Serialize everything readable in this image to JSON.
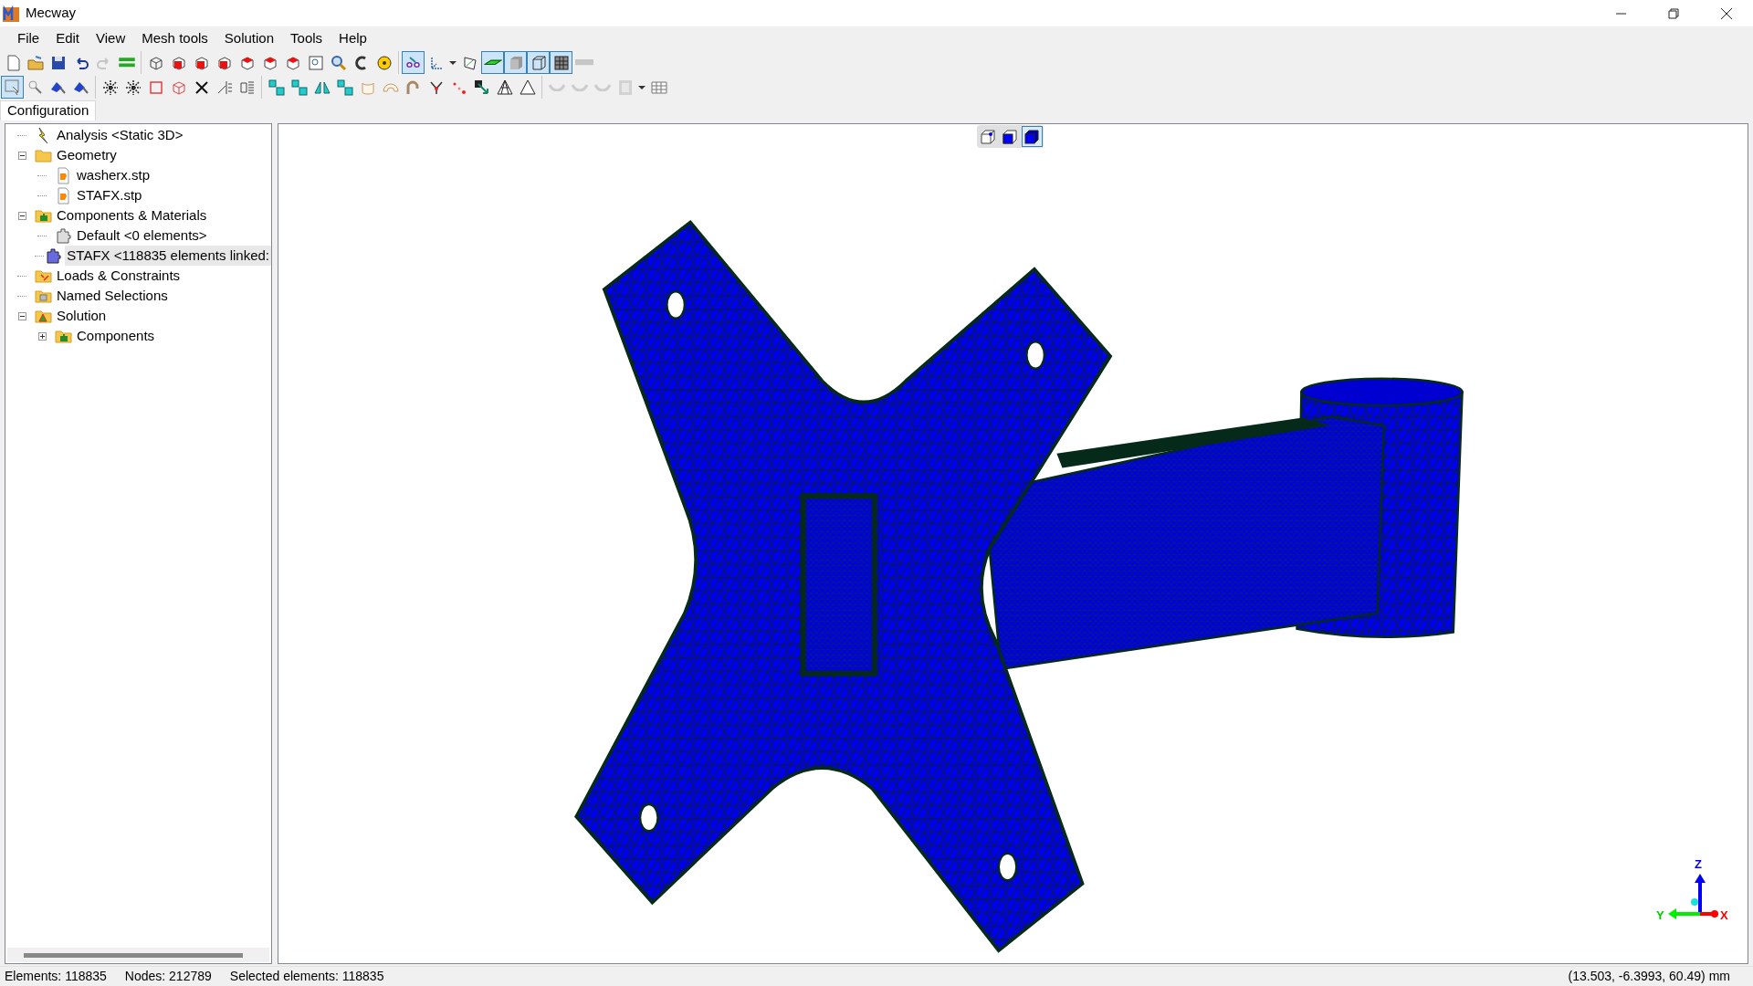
{
  "window": {
    "title": "Mecway"
  },
  "menu": [
    "File",
    "Edit",
    "View",
    "Mesh tools",
    "Solution",
    "Tools",
    "Help"
  ],
  "toolbars": [
    {
      "groups": [
        {
          "buttons": [
            {
              "kind": "new",
              "pressed": false,
              "disabled": false
            },
            {
              "kind": "open",
              "pressed": false,
              "disabled": false
            },
            {
              "kind": "save",
              "pressed": false,
              "disabled": false
            },
            {
              "kind": "undo",
              "pressed": false,
              "disabled": false
            },
            {
              "kind": "redo",
              "pressed": false,
              "disabled": true
            },
            {
              "kind": "lines-green",
              "pressed": false,
              "disabled": false
            }
          ]
        },
        {
          "buttons": [
            {
              "kind": "cube-wire",
              "pressed": false,
              "disabled": false
            },
            {
              "kind": "cube-red",
              "pressed": false,
              "disabled": false
            },
            {
              "kind": "cube-red",
              "pressed": false,
              "disabled": false
            },
            {
              "kind": "cube-red",
              "pressed": false,
              "disabled": false
            },
            {
              "kind": "cube-red-top",
              "pressed": false,
              "disabled": false
            },
            {
              "kind": "cube-red-top",
              "pressed": false,
              "disabled": false
            },
            {
              "kind": "cube-red-top",
              "pressed": false,
              "disabled": false
            },
            {
              "kind": "zoom-box",
              "pressed": false,
              "disabled": false
            },
            {
              "kind": "magnifier",
              "pressed": false,
              "disabled": false
            },
            {
              "kind": "rotate",
              "pressed": false,
              "disabled": false
            },
            {
              "kind": "tape",
              "pressed": false,
              "disabled": false
            }
          ]
        },
        {
          "buttons": [
            {
              "kind": "glasses",
              "pressed": true,
              "disabled": false
            },
            {
              "kind": "axes",
              "pressed": false,
              "disabled": false
            },
            {
              "kind": "caret",
              "pressed": false,
              "disabled": false
            },
            {
              "kind": "sketch",
              "pressed": false,
              "disabled": false
            },
            {
              "kind": "layer-green",
              "pressed": true,
              "disabled": false
            },
            {
              "kind": "shaded",
              "pressed": true,
              "disabled": false
            },
            {
              "kind": "wireframe",
              "pressed": true,
              "disabled": false
            },
            {
              "kind": "mesh",
              "pressed": true,
              "disabled": false
            },
            {
              "kind": "bar-gray",
              "pressed": false,
              "disabled": true
            }
          ]
        }
      ]
    },
    {
      "groups": [
        {
          "buttons": [
            {
              "kind": "select",
              "pressed": true,
              "disabled": false
            },
            {
              "kind": "select-point",
              "pressed": false,
              "disabled": false
            },
            {
              "kind": "select-blue",
              "pressed": false,
              "disabled": false
            },
            {
              "kind": "select-blue",
              "pressed": false,
              "disabled": false
            }
          ]
        },
        {
          "buttons": [
            {
              "kind": "nodes-star",
              "pressed": false,
              "disabled": false
            },
            {
              "kind": "nodes-star",
              "pressed": false,
              "disabled": false
            },
            {
              "kind": "square-red",
              "pressed": false,
              "disabled": false
            },
            {
              "kind": "cube-red-wire",
              "pressed": false,
              "disabled": false
            },
            {
              "kind": "cross",
              "pressed": false,
              "disabled": false
            },
            {
              "kind": "tool-split",
              "pressed": false,
              "disabled": false
            },
            {
              "kind": "tool-list",
              "pressed": false,
              "disabled": false
            }
          ]
        },
        {
          "buttons": [
            {
              "kind": "cyan-move",
              "pressed": false,
              "disabled": false
            },
            {
              "kind": "cyan-move",
              "pressed": false,
              "disabled": false
            },
            {
              "kind": "cyan-mirror",
              "pressed": false,
              "disabled": false
            },
            {
              "kind": "cyan-move",
              "pressed": false,
              "disabled": false
            },
            {
              "kind": "cylinder",
              "pressed": false,
              "disabled": false
            },
            {
              "kind": "torus",
              "pressed": false,
              "disabled": false
            },
            {
              "kind": "pipe",
              "pressed": false,
              "disabled": false
            },
            {
              "kind": "merge",
              "pressed": false,
              "disabled": false
            },
            {
              "kind": "dots-red",
              "pressed": false,
              "disabled": false
            },
            {
              "kind": "arrow-diag",
              "pressed": false,
              "disabled": false
            },
            {
              "kind": "tri-mesh",
              "pressed": false,
              "disabled": false
            },
            {
              "kind": "tri-fine",
              "pressed": false,
              "disabled": false
            }
          ]
        },
        {
          "buttons": [
            {
              "kind": "shell-gray",
              "pressed": false,
              "disabled": true
            },
            {
              "kind": "shell-gray",
              "pressed": false,
              "disabled": true
            },
            {
              "kind": "shell-gray",
              "pressed": false,
              "disabled": true
            },
            {
              "kind": "film",
              "pressed": false,
              "disabled": true
            },
            {
              "kind": "caret",
              "pressed": false,
              "disabled": false
            },
            {
              "kind": "table",
              "pressed": false,
              "disabled": false
            }
          ]
        }
      ]
    }
  ],
  "panel_tab": {
    "label": "Configuration",
    "selected": true
  },
  "tree": [
    {
      "label": "Analysis <Static 3D>",
      "kind": "lightning",
      "selected": false
    },
    {
      "label": "Geometry",
      "kind": "folder",
      "expanded": true,
      "selected": false,
      "children": [
        {
          "label": "washerx.stp",
          "kind": "file",
          "selected": false
        },
        {
          "label": "STAFX.stp",
          "kind": "file",
          "selected": false
        }
      ]
    },
    {
      "label": "Components & Materials",
      "kind": "folder-puzzle",
      "expanded": true,
      "selected": false,
      "children": [
        {
          "label": "Default <0 elements>",
          "kind": "puzzle-gray",
          "selected": false
        },
        {
          "label": "STAFX <118835 elements linked:",
          "kind": "puzzle-blue",
          "selected": true
        }
      ]
    },
    {
      "label": "Loads & Constraints",
      "kind": "folder-load",
      "selected": false
    },
    {
      "label": "Named Selections",
      "kind": "folder-named",
      "selected": false
    },
    {
      "label": "Solution",
      "kind": "folder-solution",
      "expanded": true,
      "selected": false,
      "children": [
        {
          "label": "Components",
          "kind": "folder-puzzle",
          "expanded": false,
          "selected": false
        }
      ]
    }
  ],
  "view_buttons": [
    {
      "kind": "node-cube",
      "selected": false
    },
    {
      "kind": "solid-cube",
      "selected": false
    },
    {
      "kind": "shaded-cube",
      "selected": true
    }
  ],
  "axis_labels": {
    "z": "Z",
    "y": "Y",
    "x": "X"
  },
  "status_bar": {
    "elements": "Elements: 118835",
    "nodes": "Nodes: 212789",
    "selected": "Selected elements: 118835",
    "coordinates": "(13.503, -6.3993, 60.49) mm"
  }
}
